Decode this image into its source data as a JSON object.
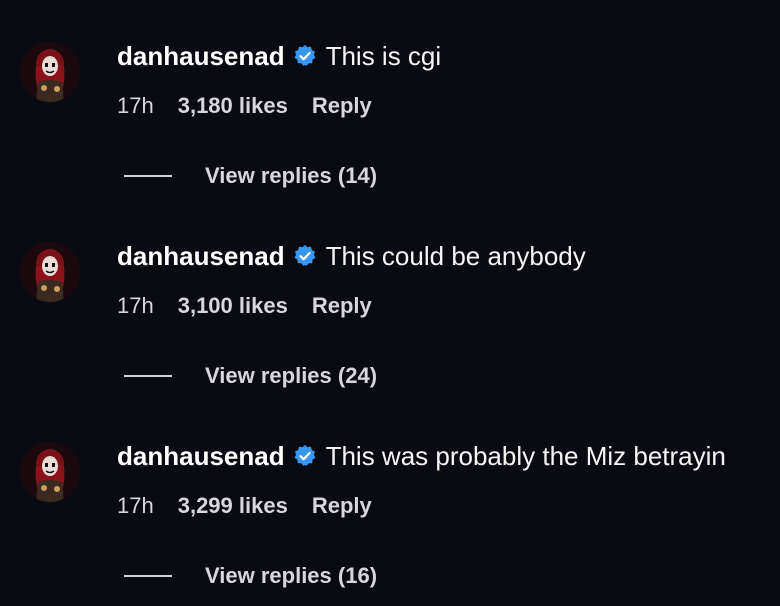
{
  "colors": {
    "background": "#0a0a12",
    "verified_badge": "#3897f0",
    "text_primary": "#ffffff",
    "text_secondary": "#d6d6dc"
  },
  "comments": [
    {
      "username": "danhausenad",
      "verified": true,
      "avatar_icon": "avatar-icon",
      "text": "This is cgi",
      "time": "17h",
      "likes": "3,180 likes",
      "reply_label": "Reply",
      "view_replies": "View replies (14)"
    },
    {
      "username": "danhausenad",
      "verified": true,
      "avatar_icon": "avatar-icon",
      "text": "This could be anybody",
      "time": "17h",
      "likes": "3,100 likes",
      "reply_label": "Reply",
      "view_replies": "View replies (24)"
    },
    {
      "username": "danhausenad",
      "verified": true,
      "avatar_icon": "avatar-icon",
      "text": "This was probably the Miz betrayin",
      "time": "17h",
      "likes": "3,299 likes",
      "reply_label": "Reply",
      "view_replies": "View replies (16)"
    }
  ]
}
